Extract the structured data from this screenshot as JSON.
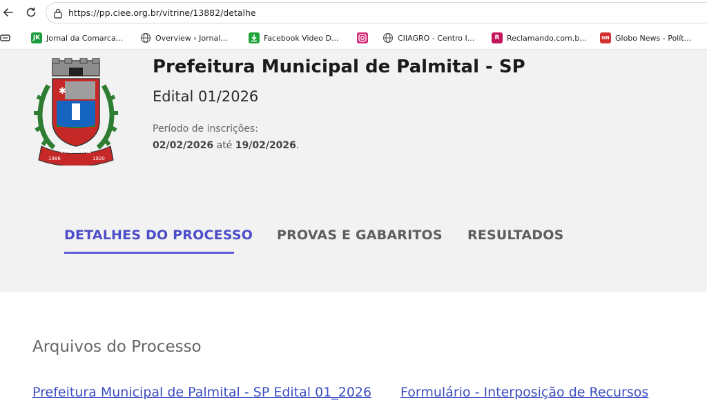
{
  "browser": {
    "url": "https://pp.ciee.org.br/vitrine/13882/detalhe",
    "bookmarks": [
      {
        "label": "Jornal da Comarca...",
        "icon": "jk-icon",
        "color": "#1a9b3c"
      },
      {
        "label": "Overview ‹ Jornal...",
        "icon": "globe-icon",
        "color": "#555555"
      },
      {
        "label": "Facebook Video D...",
        "icon": "download-icon",
        "color": "#1fa33a"
      },
      {
        "label": "",
        "icon": "instagram-icon",
        "color": "#d62976"
      },
      {
        "label": "CIIAGRO - Centro I...",
        "icon": "globe-icon",
        "color": "#555555"
      },
      {
        "label": "Reclamando.com.b...",
        "icon": "reclamando-icon",
        "color": "#c2185b"
      },
      {
        "label": "Globo News - Polít...",
        "icon": "gn-icon",
        "color": "#d32f2f"
      }
    ]
  },
  "header": {
    "title": "Prefeitura Municipal de Palmital - SP",
    "edital": "Edital 01/2026",
    "periodo_label": "Período de inscrições:",
    "data_inicio": "02/02/2026",
    "ate": "até",
    "data_fim": "19/02/2026",
    "ponto": ".",
    "crest": {
      "name": "PALMITAL",
      "year_left": "1886",
      "year_right": "1920"
    }
  },
  "tabs": [
    {
      "label": "DETALHES DO PROCESSO",
      "active": true
    },
    {
      "label": "PROVAS E GABARITOS",
      "active": false
    },
    {
      "label": "RESULTADOS",
      "active": false
    }
  ],
  "arquivos": {
    "title": "Arquivos do Processo",
    "links": [
      "Prefeitura Municipal de Palmital - SP Edital 01_2026",
      "Formulário - Interposição de Recursos"
    ]
  },
  "colors": {
    "accent": "#4b4cc7",
    "link": "#3b4dc0",
    "hero_bg": "#f2f2f2"
  }
}
